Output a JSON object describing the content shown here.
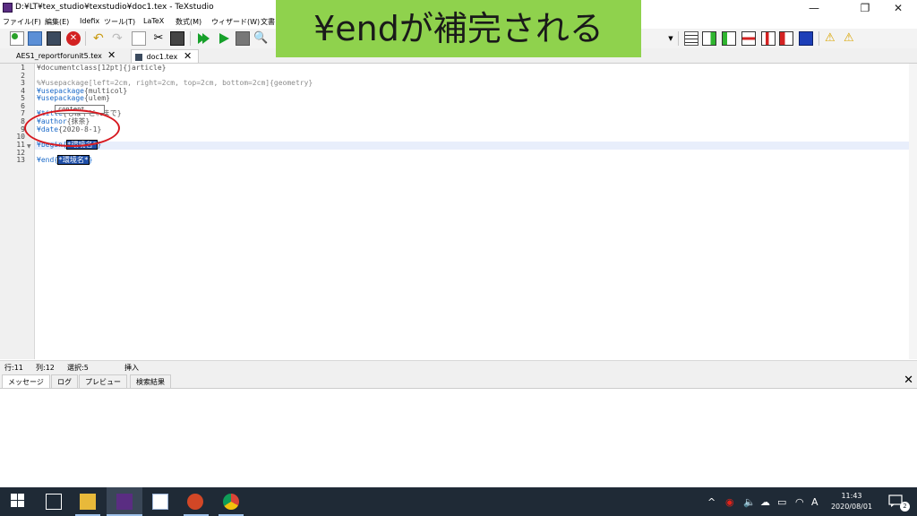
{
  "window": {
    "title": "D:¥LT¥tex_studio¥texstudio¥doc1.tex - TeXstudio",
    "minimize_glyph": "—",
    "restore_glyph": "❐",
    "close_glyph": "✕"
  },
  "menu": [
    "ファイル(F)",
    "編集(E)",
    "Idefix",
    "ツール(T)",
    "LaTeX",
    "数式(M)",
    "ウィザード(W)",
    "文書"
  ],
  "caption": "¥endが補完される",
  "tabs": [
    {
      "label": "AES1_reportforunit5.tex",
      "close": "✕"
    },
    {
      "label": "doc1.tex",
      "close": "✕"
    }
  ],
  "editor": {
    "line_numbers": [
      "1",
      "2",
      "3",
      "4",
      "5",
      "6",
      "7",
      "8",
      "9",
      "10",
      "11",
      "12",
      "13"
    ],
    "lines": [
      {
        "a": "¥documentclass[12pt]{jarticle}"
      },
      {
        "a": ""
      },
      {
        "a": "%¥usepackage[left=2cm, right=2cm, top=2cm, bottom=2cm]{geometry}"
      },
      {
        "k": "¥usepackage",
        "r": "{multicol}"
      },
      {
        "k": "¥usepackage",
        "r": "{ulem}"
      },
      {
        "a": ""
      },
      {
        "k": "¥title",
        "r": "{もはやこれまで}"
      },
      {
        "k": "¥author",
        "r": "{抹茶}"
      },
      {
        "k": "¥date",
        "r": "{2020-8-1}"
      },
      {
        "a": ""
      },
      {
        "k": "¥begin",
        "b": "{",
        "s": "*環境名*",
        "e": "}"
      },
      {
        "a": ""
      },
      {
        "k": "¥end",
        "b": "{",
        "s": "*環境名*",
        "e": "}"
      }
    ],
    "popup": "content..."
  },
  "status": {
    "row": "行:11",
    "col": "列:12",
    "selection": "選択:5",
    "mode": "挿入"
  },
  "panel": {
    "tabs": [
      "メッセージ",
      "ログ",
      "プレビュー",
      "検索結果"
    ],
    "close": "✕"
  },
  "toolbar": {
    "dropdown_arrow": "▼",
    "warning_glyph": "⚠"
  },
  "taskbar": {
    "time": "11:43",
    "date": "2020/08/01",
    "ime": "A",
    "notifications": "2",
    "tray_chevron": "^"
  },
  "colors": {
    "caption_bg": "#8fd24d",
    "selection": "#1f4fa8",
    "keyword": "#1b6ac9",
    "annotation_circle": "#d71920",
    "taskbar": "#1f2a36"
  }
}
